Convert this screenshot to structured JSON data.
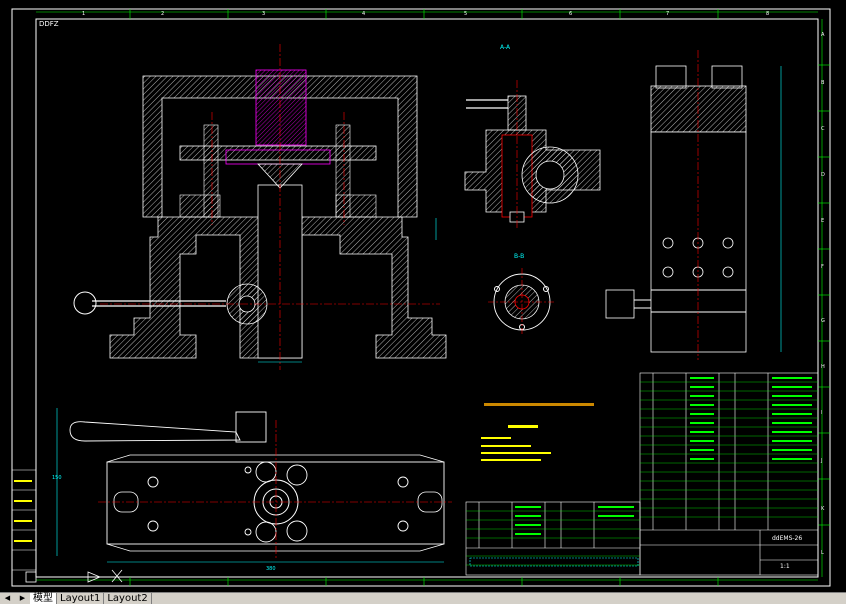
{
  "drawing": {
    "sheet_code": "DDFZ",
    "zone_numbers": [
      "1",
      "2",
      "3",
      "4",
      "5",
      "6",
      "7",
      "8"
    ],
    "zone_letters": [
      "A",
      "B",
      "C",
      "D",
      "E",
      "F",
      "G",
      "H",
      "I",
      "J",
      "K",
      "L"
    ],
    "section_aa": "A-A",
    "section_bb": "B-B",
    "dimension_main": "380",
    "dimension_side": "150",
    "title_block": {
      "drawing_no": "ddEMS-26",
      "scale": "1:1"
    }
  },
  "tabs": {
    "model": "模型",
    "layout1": "Layout1",
    "layout2": "Layout2"
  },
  "colors": {
    "frame": "#ffffff",
    "grid": "#00ff00",
    "centerline": "#ff0000",
    "hatch": "#ffffff",
    "highlight": "#ff00ff",
    "dimension": "#00ffff",
    "text": "#ffff00"
  }
}
